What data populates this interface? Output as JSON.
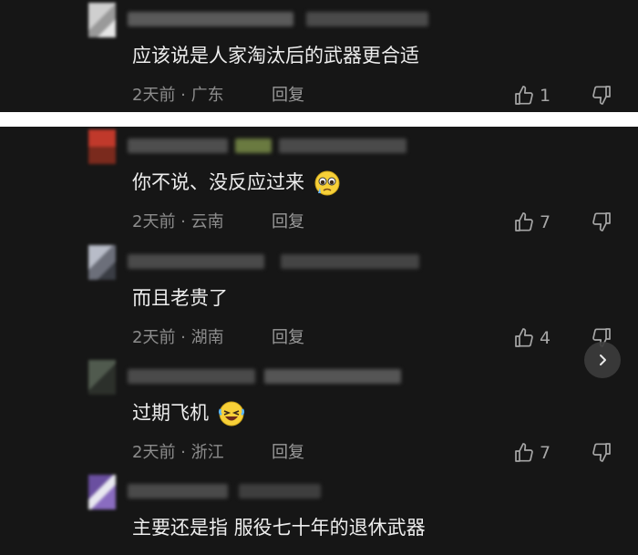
{
  "comments": [
    {
      "text": "应该说是人家淘汰后的武器更合适",
      "time": "2天前",
      "location": "广东",
      "reply_label": "回复",
      "likes": "1"
    },
    {
      "text": "你不说、没反应过来",
      "emoji": "pleading-face",
      "time": "2天前",
      "location": "云南",
      "reply_label": "回复",
      "likes": "7"
    },
    {
      "text": "而且老贵了",
      "time": "2天前",
      "location": "湖南",
      "reply_label": "回复",
      "likes": "4"
    },
    {
      "text": "过期飞机",
      "emoji": "rolling-on-floor-laughing",
      "time": "2天前",
      "location": "浙江",
      "reply_label": "回复",
      "likes": "7"
    },
    {
      "text": "主要还是指 服役七十年的退休武器"
    }
  ],
  "meta_separator": " · ",
  "icons": {
    "like": "thumb-up-icon",
    "dislike": "thumb-down-icon",
    "next": "chevron-right-icon"
  },
  "colors": {
    "background": "#161616",
    "text": "#ededed",
    "meta": "#8c8c8c",
    "separator": "#ffffff"
  }
}
